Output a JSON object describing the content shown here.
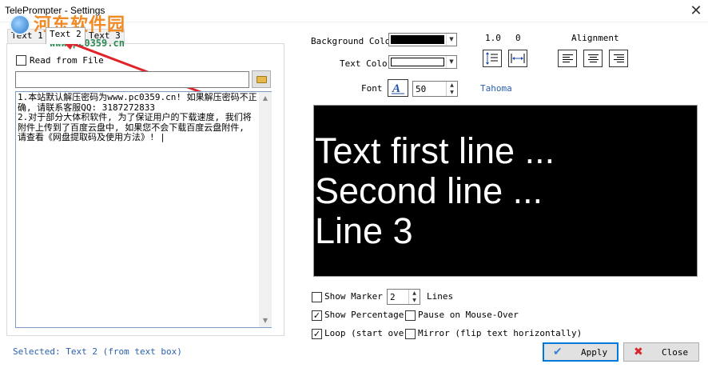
{
  "window": {
    "title": "TelePrompter - Settings",
    "close_glyph": "✕"
  },
  "watermark": {
    "text": "河东软件园",
    "url": "www.pc0359.cn",
    "logo_icon": "globe-icon",
    "text_color": "#f08a24",
    "url_color": "#2e8b57"
  },
  "tabs": [
    {
      "label": "Text 1",
      "active": false
    },
    {
      "label": "Text 2",
      "active": true
    },
    {
      "label": "Text 3",
      "active": false
    }
  ],
  "left_panel": {
    "read_from_file_label": "Read from File",
    "read_from_file_checked": false,
    "file_path_value": "",
    "browse_icon": "folder-open-icon",
    "text_content": "1.本站默认解压密码为www.pc0359.cn! 如果解压密码不正确, 请联系客服QQ: 3187272833\n2.对于部分大体积软件, 为了保证用户的下载速度, 我们将附件上传到了百度云盘中, 如果您不会下载百度云盘附件, 请查看《网盘提取码及使用方法》! |"
  },
  "status": {
    "text": "Selected: Text 2 (from text box)",
    "color": "#2a5fb0"
  },
  "colors": {
    "background_color_label": "Background Color",
    "background_color_value": "#000000",
    "text_color_label": "Text Color",
    "text_color_value": "#ffffff"
  },
  "spacing": {
    "line_spacing_value": "1.0",
    "char_spacing_value": "0",
    "line_spacing_icon": "line-spacing-icon",
    "char_spacing_icon": "char-spacing-icon"
  },
  "alignment": {
    "label": "Alignment",
    "left_icon": "align-left-icon",
    "center_icon": "align-center-icon",
    "right_icon": "align-right-icon"
  },
  "font": {
    "label": "Font",
    "icon": "font-picker-icon",
    "size": "50",
    "name": "Tahoma",
    "name_color": "#2a5fb0"
  },
  "preview": {
    "lines": [
      "Text first line ...",
      "Second line ...",
      "Line 3"
    ]
  },
  "options": {
    "show_marker_label": "Show Marker",
    "show_marker_checked": false,
    "marker_lines_value": "2",
    "marker_lines_label": "Lines",
    "show_percentage_label": "Show Percentage",
    "show_percentage_checked": true,
    "pause_mouse_over_label": "Pause on Mouse-Over",
    "pause_mouse_over_checked": false,
    "loop_label": "Loop (start over)",
    "loop_checked": true,
    "mirror_label": "Mirror (flip text horizontally)",
    "mirror_checked": false
  },
  "buttons": {
    "apply_label": "Apply",
    "apply_icon": "checkmark-icon",
    "close_label": "Close",
    "close_icon": "red-x-icon"
  }
}
